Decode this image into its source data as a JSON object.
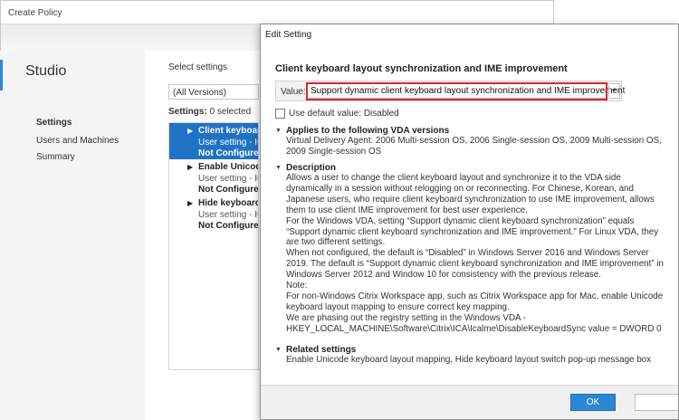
{
  "window": {
    "title": "Create Policy"
  },
  "nav": {
    "app_title": "Studio",
    "items": [
      {
        "label": "Settings"
      },
      {
        "label": "Users and Machines"
      },
      {
        "label": "Summary"
      }
    ]
  },
  "main": {
    "select_label": "Select settings",
    "version_filter": "(All Versions)",
    "settings_count_label": "Settings:",
    "settings_count_value": "0 selected",
    "settings": [
      {
        "name": "Client keyboard",
        "scope": "User setting - IC",
        "state": "Not Configured"
      },
      {
        "name": "Enable Unicode",
        "scope": "User setting - IC",
        "state": "Not Configured"
      },
      {
        "name": "Hide keyboard",
        "scope": "User setting - IC",
        "state": "Not Configured"
      }
    ]
  },
  "dialog": {
    "title": "Edit Setting",
    "heading": "Client keyboard layout synchronization and IME improvement",
    "value_label": "Value:",
    "value_selected": "Support dynamic client keyboard layout synchronization and IME improvement",
    "use_default_label": "Use default value: Disabled",
    "applies_head": "Applies to the following VDA versions",
    "applies_body": "Virtual Delivery Agent: 2006 Multi-session OS, 2006 Single-session OS, 2009 Multi-session OS, 2009 Single-session OS",
    "desc_head": "Description",
    "desc_lines": [
      "Allows a user to change the client keyboard layout and synchronize it to the VDA side dynamically in a session without relogging on or reconnecting. For Chinese, Korean, and Japanese users, who require client keyboard synchronization to use IME improvement, allows them to use client IME improvement for best user experience.",
      "For the Windows VDA, setting “Support dynamic client keyboard synchronization” equals “Support dynamic client keyboard synchronization and IME improvement.” For Linux VDA, they are two different settings.",
      "When not configured, the default is “Disabled” in Windows Server 2016 and Windows Server 2019. The default is “Support dynamic client keyboard synchronization and IME improvement” in Windows Server 2012 and Window 10 for consistency with the previous release.",
      "Note:",
      "For non-Windows Citrix Workspace app, such as Citrix Workspace app for Mac, enable Unicode keyboard layout mapping to ensure correct key mapping.",
      "We are phasing out the registry setting in the Windows VDA - HKEY_LOCAL_MACHINE\\Software\\Citrix\\ICA\\Icalme\\DisableKeyboardSync value = DWORD 0"
    ],
    "related_head": "Related settings",
    "related_body": "Enable Unicode keyboard layout mapping, Hide keyboard layout switch pop-up message box",
    "ok_label": "OK"
  },
  "colors": {
    "accent": "#2d86d2",
    "selection": "#1f72c4",
    "highlight_border": "#e2262d"
  }
}
